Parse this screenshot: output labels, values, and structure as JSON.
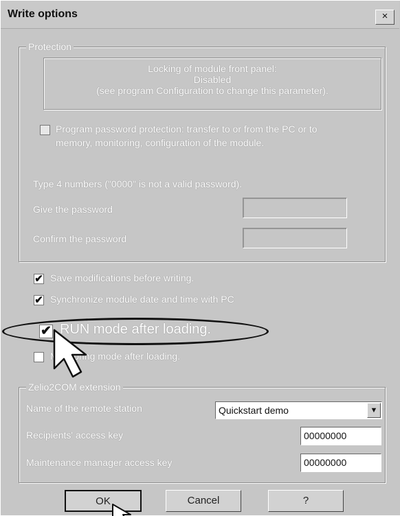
{
  "window": {
    "title": "Write options",
    "close": "×"
  },
  "protection": {
    "legend": "Protection",
    "info": [
      "Locking of module front panel:",
      "Disabled",
      "(see program Configuration to change this parameter)."
    ],
    "password_protection_label_1": "Program password protection: transfer to or from the PC or to",
    "password_protection_label_2": "memory, monitoring, configuration of the module.",
    "hint": "Type 4 numbers (\"0000\" is not a valid password).",
    "give_password_label": "Give the password",
    "confirm_password_label": "Confirm the password"
  },
  "options": {
    "save_mods": "Save modifications before writing.",
    "sync_date": "Synchronize module date and time with PC",
    "run_mode": "RUN mode after loading.",
    "monitoring_mode": "Monitoring mode after loading.",
    "check_glyph": "✔"
  },
  "zelio": {
    "legend": "Zelio2COM extension",
    "remote_station_label": "Name of the remote station",
    "remote_station_value": "Quickstart demo",
    "recipients_key_label": "Recipients' access key",
    "recipients_key_value": "00000000",
    "maintenance_key_label": "Maintenance manager access key",
    "maintenance_key_value": "00000000"
  },
  "buttons": {
    "ok": "OK",
    "cancel": "Cancel",
    "help": "?"
  },
  "icons": {
    "dropdown_arrow": "▼"
  },
  "colors": {
    "background": "#c6c6c6",
    "highlight": "#111111"
  }
}
